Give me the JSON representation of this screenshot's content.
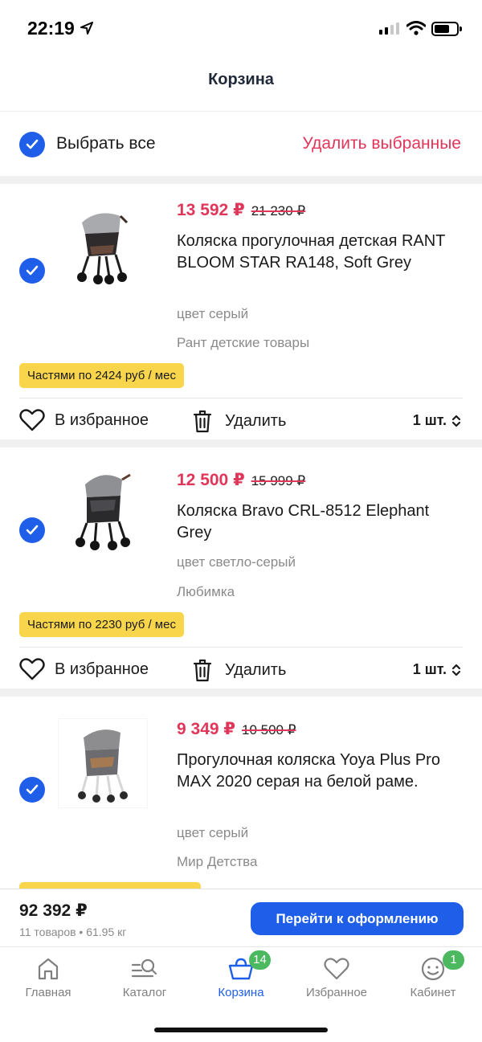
{
  "status_bar": {
    "time": "22:19"
  },
  "header": {
    "title": "Корзина"
  },
  "select_all": {
    "label": "Выбрать все",
    "delete_selected": "Удалить выбранные"
  },
  "items": [
    {
      "price": "13 592 ₽",
      "old_price": "21 230 ₽",
      "title": "Коляска прогулочная детская RANT BLOOM STAR RA148, Soft Grey",
      "color": "цвет серый",
      "seller": "Рант детские товары",
      "installments": "Частями по 2424 руб / мес",
      "favorite": "В избранное",
      "delete": "Удалить",
      "qty": "1 шт."
    },
    {
      "price": "12 500 ₽",
      "old_price": "15 999 ₽",
      "title": "Коляска Bravo CRL-8512 Elephant Grey",
      "color": "цвет светло-серый",
      "seller": "Любимка",
      "installments": "Частями по 2230 руб / мес",
      "favorite": "В избранное",
      "delete": "Удалить",
      "qty": "1 шт."
    },
    {
      "price": "9 349 ₽",
      "old_price": "10 500 ₽",
      "title": "Прогулочная коляска Yoya Plus Pro MAX 2020 серая на белой раме.",
      "color": "цвет серый",
      "seller": "Мир Детства"
    }
  ],
  "summary": {
    "total": "92 392 ₽",
    "meta": "11 товаров • 61.95 кг",
    "checkout": "Перейти к оформлению"
  },
  "tabs": [
    {
      "label": "Главная",
      "icon": "home-icon"
    },
    {
      "label": "Каталог",
      "icon": "catalog-search-icon"
    },
    {
      "label": "Корзина",
      "icon": "basket-icon",
      "badge": "14",
      "active": true
    },
    {
      "label": "Избранное",
      "icon": "heart-icon"
    },
    {
      "label": "Кабинет",
      "icon": "profile-smile-icon",
      "badge": "1"
    }
  ],
  "colors": {
    "accent": "#1e5ee8",
    "price": "#e0365a",
    "installments_bg": "#f8d54a",
    "badge": "#4cb860"
  }
}
